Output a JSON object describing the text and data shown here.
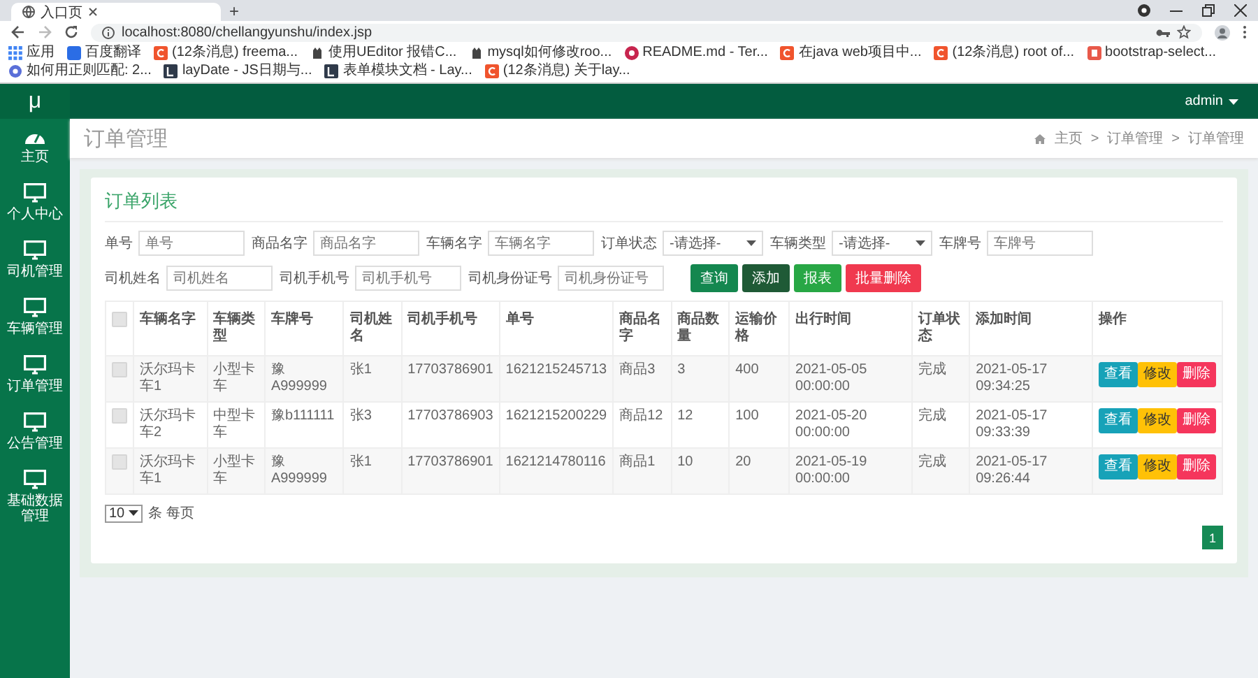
{
  "browser": {
    "tab_title": "入口页",
    "new_tab": "+",
    "url": "localhost:8080/chellangyunshu/index.jsp",
    "bookmarks": [
      {
        "label": "应用",
        "kind": "apps"
      },
      {
        "label": "百度翻译",
        "kind": "translate"
      },
      {
        "label": "(12条消息) freema...",
        "kind": "csdn"
      },
      {
        "label": "使用UEditor 报错C...",
        "kind": "cat"
      },
      {
        "label": "mysql如何修改roo...",
        "kind": "cat"
      },
      {
        "label": "README.md - Ter...",
        "kind": "readme"
      },
      {
        "label": "在java web项目中...",
        "kind": "csdn"
      },
      {
        "label": "(12条消息) root of...",
        "kind": "csdn"
      },
      {
        "label": "bootstrap-select...",
        "kind": "bootstrap"
      },
      {
        "label": "如何用正则匹配: 2...",
        "kind": "web"
      },
      {
        "label": "layDate - JS日期与...",
        "kind": "layui"
      },
      {
        "label": "表单模块文档 - Lay...",
        "kind": "layui"
      },
      {
        "label": "(12条消息) 关于lay...",
        "kind": "csdn"
      }
    ]
  },
  "app": {
    "logo": "μ",
    "user": "admin"
  },
  "sidebar": {
    "items": [
      {
        "label": "主页",
        "kind": "dashboard"
      },
      {
        "label": "个人中心",
        "kind": "monitor"
      },
      {
        "label": "司机管理",
        "kind": "monitor"
      },
      {
        "label": "车辆管理",
        "kind": "monitor"
      },
      {
        "label": "订单管理",
        "kind": "monitor"
      },
      {
        "label": "公告管理",
        "kind": "monitor"
      },
      {
        "label": "基础数据管理",
        "kind": "monitor"
      }
    ]
  },
  "page_header": {
    "title": "订单管理",
    "breadcrumb": [
      "主页",
      "订单管理",
      "订单管理"
    ],
    "separator": ">"
  },
  "card": {
    "title": "订单列表",
    "filters": [
      {
        "label": "单号",
        "kind": "input",
        "placeholder": "单号"
      },
      {
        "label": "商品名字",
        "kind": "input",
        "placeholder": "商品名字"
      },
      {
        "label": "车辆名字",
        "kind": "input",
        "placeholder": "车辆名字"
      },
      {
        "label": "订单状态",
        "kind": "select",
        "value": "-请选择-"
      },
      {
        "label": "车辆类型",
        "kind": "select",
        "value": "-请选择-"
      },
      {
        "label": "车牌号",
        "kind": "input",
        "placeholder": "车牌号"
      },
      {
        "label": "司机姓名",
        "kind": "input",
        "placeholder": "司机姓名"
      },
      {
        "label": "司机手机号",
        "kind": "input",
        "placeholder": "司机手机号"
      },
      {
        "label": "司机身份证号",
        "kind": "input",
        "placeholder": "司机身份证号"
      }
    ],
    "buttons": [
      {
        "label": "查询",
        "color": "#14874f"
      },
      {
        "label": "添加",
        "color": "#1f5a36"
      },
      {
        "label": "报表",
        "color": "#28a745"
      },
      {
        "label": "批量删除",
        "color": "#f0394f"
      }
    ],
    "table": {
      "select_all": {
        "checked": false
      },
      "columns": [
        "车辆名字",
        "车辆类型",
        "车牌号",
        "司机姓名",
        "司机手机号",
        "单号",
        "商品名字",
        "商品数量",
        "运输价格",
        "出行时间",
        "订单状态",
        "添加时间",
        "操作"
      ],
      "rows": [
        {
          "checked": false,
          "cells": [
            "沃尔玛卡车1",
            "小型卡车",
            "豫A999999",
            "张1",
            "17703786901",
            "1621215245713",
            "商品3",
            "3",
            "400",
            "2021-05-05 00:00:00",
            "完成",
            "2021-05-17 09:34:25"
          ],
          "actions": [
            {
              "label": "查看",
              "color": "#17a2b8"
            },
            {
              "label": "修改",
              "color": "#ffc107"
            },
            {
              "label": "删除",
              "color": "#f5365c"
            }
          ]
        },
        {
          "checked": false,
          "cells": [
            "沃尔玛卡车2",
            "中型卡车",
            "豫b111111",
            "张3",
            "17703786903",
            "1621215200229",
            "商品12",
            "12",
            "100",
            "2021-05-20 00:00:00",
            "完成",
            "2021-05-17 09:33:39"
          ],
          "actions": [
            {
              "label": "查看",
              "color": "#17a2b8"
            },
            {
              "label": "修改",
              "color": "#ffc107"
            },
            {
              "label": "删除",
              "color": "#f5365c"
            }
          ]
        },
        {
          "checked": false,
          "cells": [
            "沃尔玛卡车1",
            "小型卡车",
            "豫A999999",
            "张1",
            "17703786901",
            "1621214780116",
            "商品1",
            "10",
            "20",
            "2021-05-19 00:00:00",
            "完成",
            "2021-05-17 09:26:44"
          ],
          "actions": [
            {
              "label": "查看",
              "color": "#17a2b8"
            },
            {
              "label": "修改",
              "color": "#ffc107"
            },
            {
              "label": "删除",
              "color": "#f5365c"
            }
          ]
        }
      ]
    },
    "page_size": {
      "value": "10",
      "suffix": "条 每页"
    },
    "pages": [
      {
        "label": "1",
        "selected": true
      }
    ]
  }
}
